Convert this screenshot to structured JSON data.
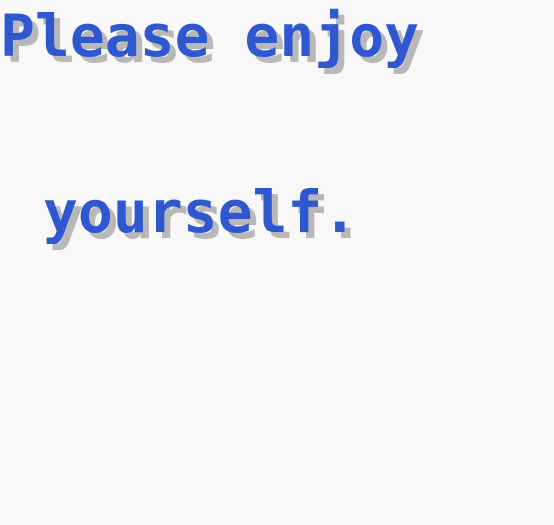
{
  "dialog": {
    "line1": "Please enjoy",
    "line2": "yourself."
  },
  "colors": {
    "background": "#f8f8f8",
    "text": "#2f58d0",
    "shadow": "#b8b8b8"
  }
}
